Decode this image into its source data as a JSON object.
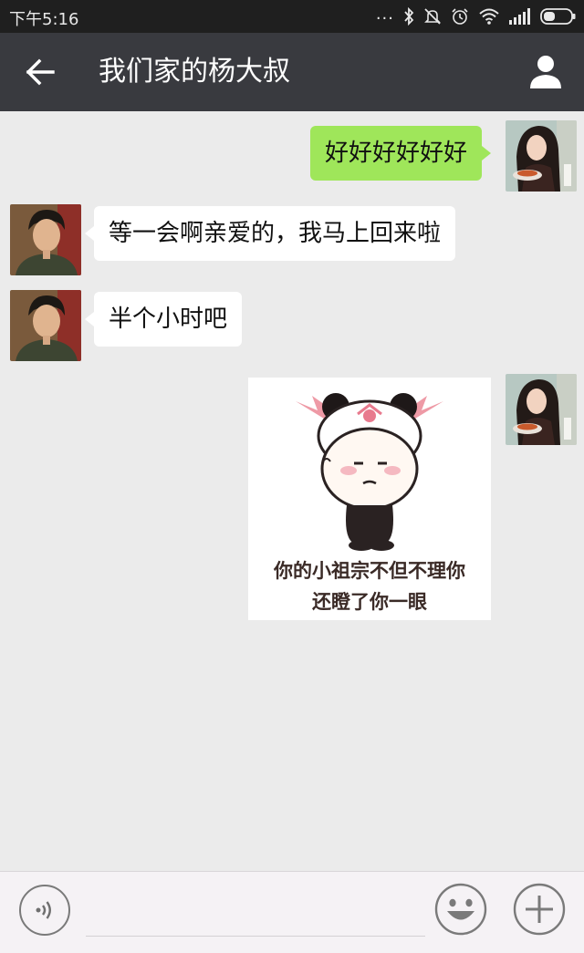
{
  "status_bar": {
    "time": "下午5:16",
    "more": "..."
  },
  "header": {
    "title": "我们家的杨大叔"
  },
  "messages": [
    {
      "direction": "sent",
      "type": "text",
      "text": "好好好好好好"
    },
    {
      "direction": "received",
      "type": "text",
      "text": "等一会啊亲爱的，我马上回来啦"
    },
    {
      "direction": "received",
      "type": "text",
      "text": "半个小时吧"
    },
    {
      "direction": "sent",
      "type": "sticker",
      "caption_line1": "你的小祖宗不但不理你",
      "caption_line2": "还瞪了你一眼"
    }
  ],
  "colors": {
    "title_bar": "#393a3f",
    "status_bar": "#1f1f1f",
    "sent_bubble": "#9fe65a",
    "received_bubble": "#ffffff",
    "chat_background": "#ebebeb"
  },
  "icons": [
    "back-arrow-icon",
    "profile-icon",
    "voice-icon",
    "emoji-icon",
    "plus-icon",
    "bluetooth-icon",
    "wifi-icon",
    "signal-icon",
    "battery-icon",
    "alarm-icon"
  ]
}
